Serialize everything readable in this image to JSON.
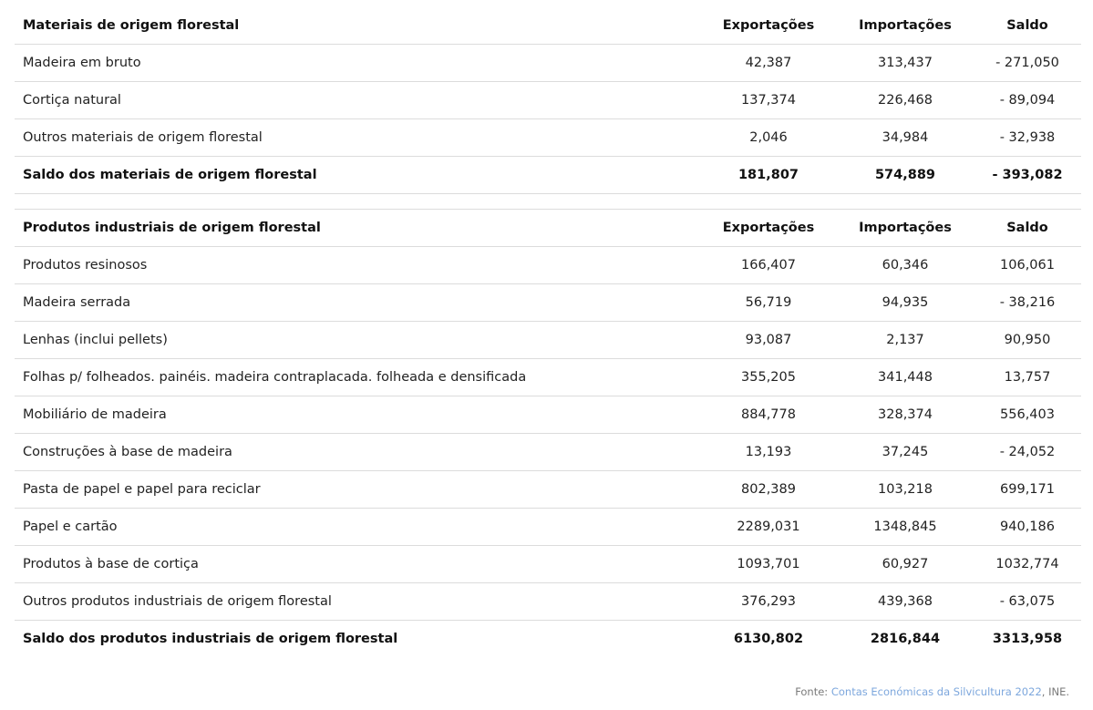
{
  "headers": {
    "exports": "Exportações",
    "imports": "Importações",
    "balance": "Saldo"
  },
  "section1": {
    "title": "Materiais de origem florestal",
    "rows": [
      {
        "name": "Madeira em bruto",
        "exp": "42,387",
        "imp": "313,437",
        "bal": "- 271,050"
      },
      {
        "name": "Cortiça natural",
        "exp": "137,374",
        "imp": "226,468",
        "bal": "- 89,094"
      },
      {
        "name": "Outros materiais de origem florestal",
        "exp": "2,046",
        "imp": "34,984",
        "bal": "- 32,938"
      }
    ],
    "total": {
      "name": "Saldo dos materiais de origem florestal",
      "exp": "181,807",
      "imp": "574,889",
      "bal": "- 393,082"
    }
  },
  "section2": {
    "title": "Produtos industriais de origem florestal",
    "rows": [
      {
        "name": "Produtos resinosos",
        "exp": "166,407",
        "imp": "60,346",
        "bal": "106,061"
      },
      {
        "name": "Madeira serrada",
        "exp": "56,719",
        "imp": "94,935",
        "bal": "- 38,216"
      },
      {
        "name": "Lenhas (inclui pellets)",
        "exp": "93,087",
        "imp": "2,137",
        "bal": "90,950"
      },
      {
        "name": "Folhas p/ folheados. painéis. madeira contraplacada. folheada e densificada",
        "exp": "355,205",
        "imp": "341,448",
        "bal": "13,757"
      },
      {
        "name": "Mobiliário de madeira",
        "exp": "884,778",
        "imp": "328,374",
        "bal": "556,403"
      },
      {
        "name": "Construções à base de madeira",
        "exp": "13,193",
        "imp": "37,245",
        "bal": "- 24,052"
      },
      {
        "name": "Pasta de papel e papel para reciclar",
        "exp": "802,389",
        "imp": "103,218",
        "bal": "699,171"
      },
      {
        "name": "Papel e cartão",
        "exp": "2289,031",
        "imp": "1348,845",
        "bal": "940,186"
      },
      {
        "name": "Produtos à base de cortiça",
        "exp": "1093,701",
        "imp": "60,927",
        "bal": "1032,774"
      },
      {
        "name": "Outros produtos industriais de origem florestal",
        "exp": "376,293",
        "imp": "439,368",
        "bal": "- 63,075"
      }
    ],
    "total": {
      "name": "Saldo dos produtos industriais de origem florestal",
      "exp": "6130,802",
      "imp": "2816,844",
      "bal": "3313,958"
    }
  },
  "source": {
    "prefix": "Fonte: ",
    "link_text": "Contas Económicas da Silvicultura 2022",
    "suffix": ", INE."
  }
}
